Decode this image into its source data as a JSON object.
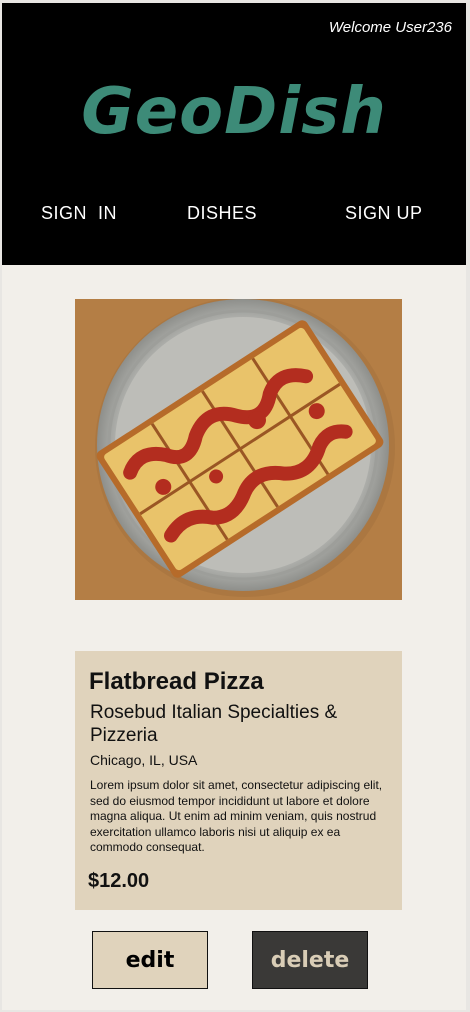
{
  "header": {
    "welcome_text": "Welcome User236",
    "logo_text": "GeoDish",
    "nav": {
      "sign_in": "SIGN  IN",
      "dishes": "DISHES",
      "sign_up": "SIGN UP"
    }
  },
  "dish": {
    "image_icon": "pizza-photo",
    "name": "Flatbread Pizza",
    "restaurant": "Rosebud Italian Specialties & Pizzeria",
    "location": "Chicago, IL, USA",
    "description": "Lorem ipsum dolor sit amet, consectetur adipiscing elit, sed do eiusmod tempor incididunt ut labore et dolore magna aliqua. Ut enim ad minim veniam, quis nostrud exercitation ullamco laboris nisi ut aliquip ex ea commodo consequat.",
    "price": "$12.00"
  },
  "actions": {
    "edit_label": "edit",
    "delete_label": "delete"
  },
  "colors": {
    "header_bg": "#000000",
    "logo": "#3d8b78",
    "page_bg": "#f2efea",
    "card_bg": "#e0d3bc",
    "delete_bg": "#3a3937"
  }
}
